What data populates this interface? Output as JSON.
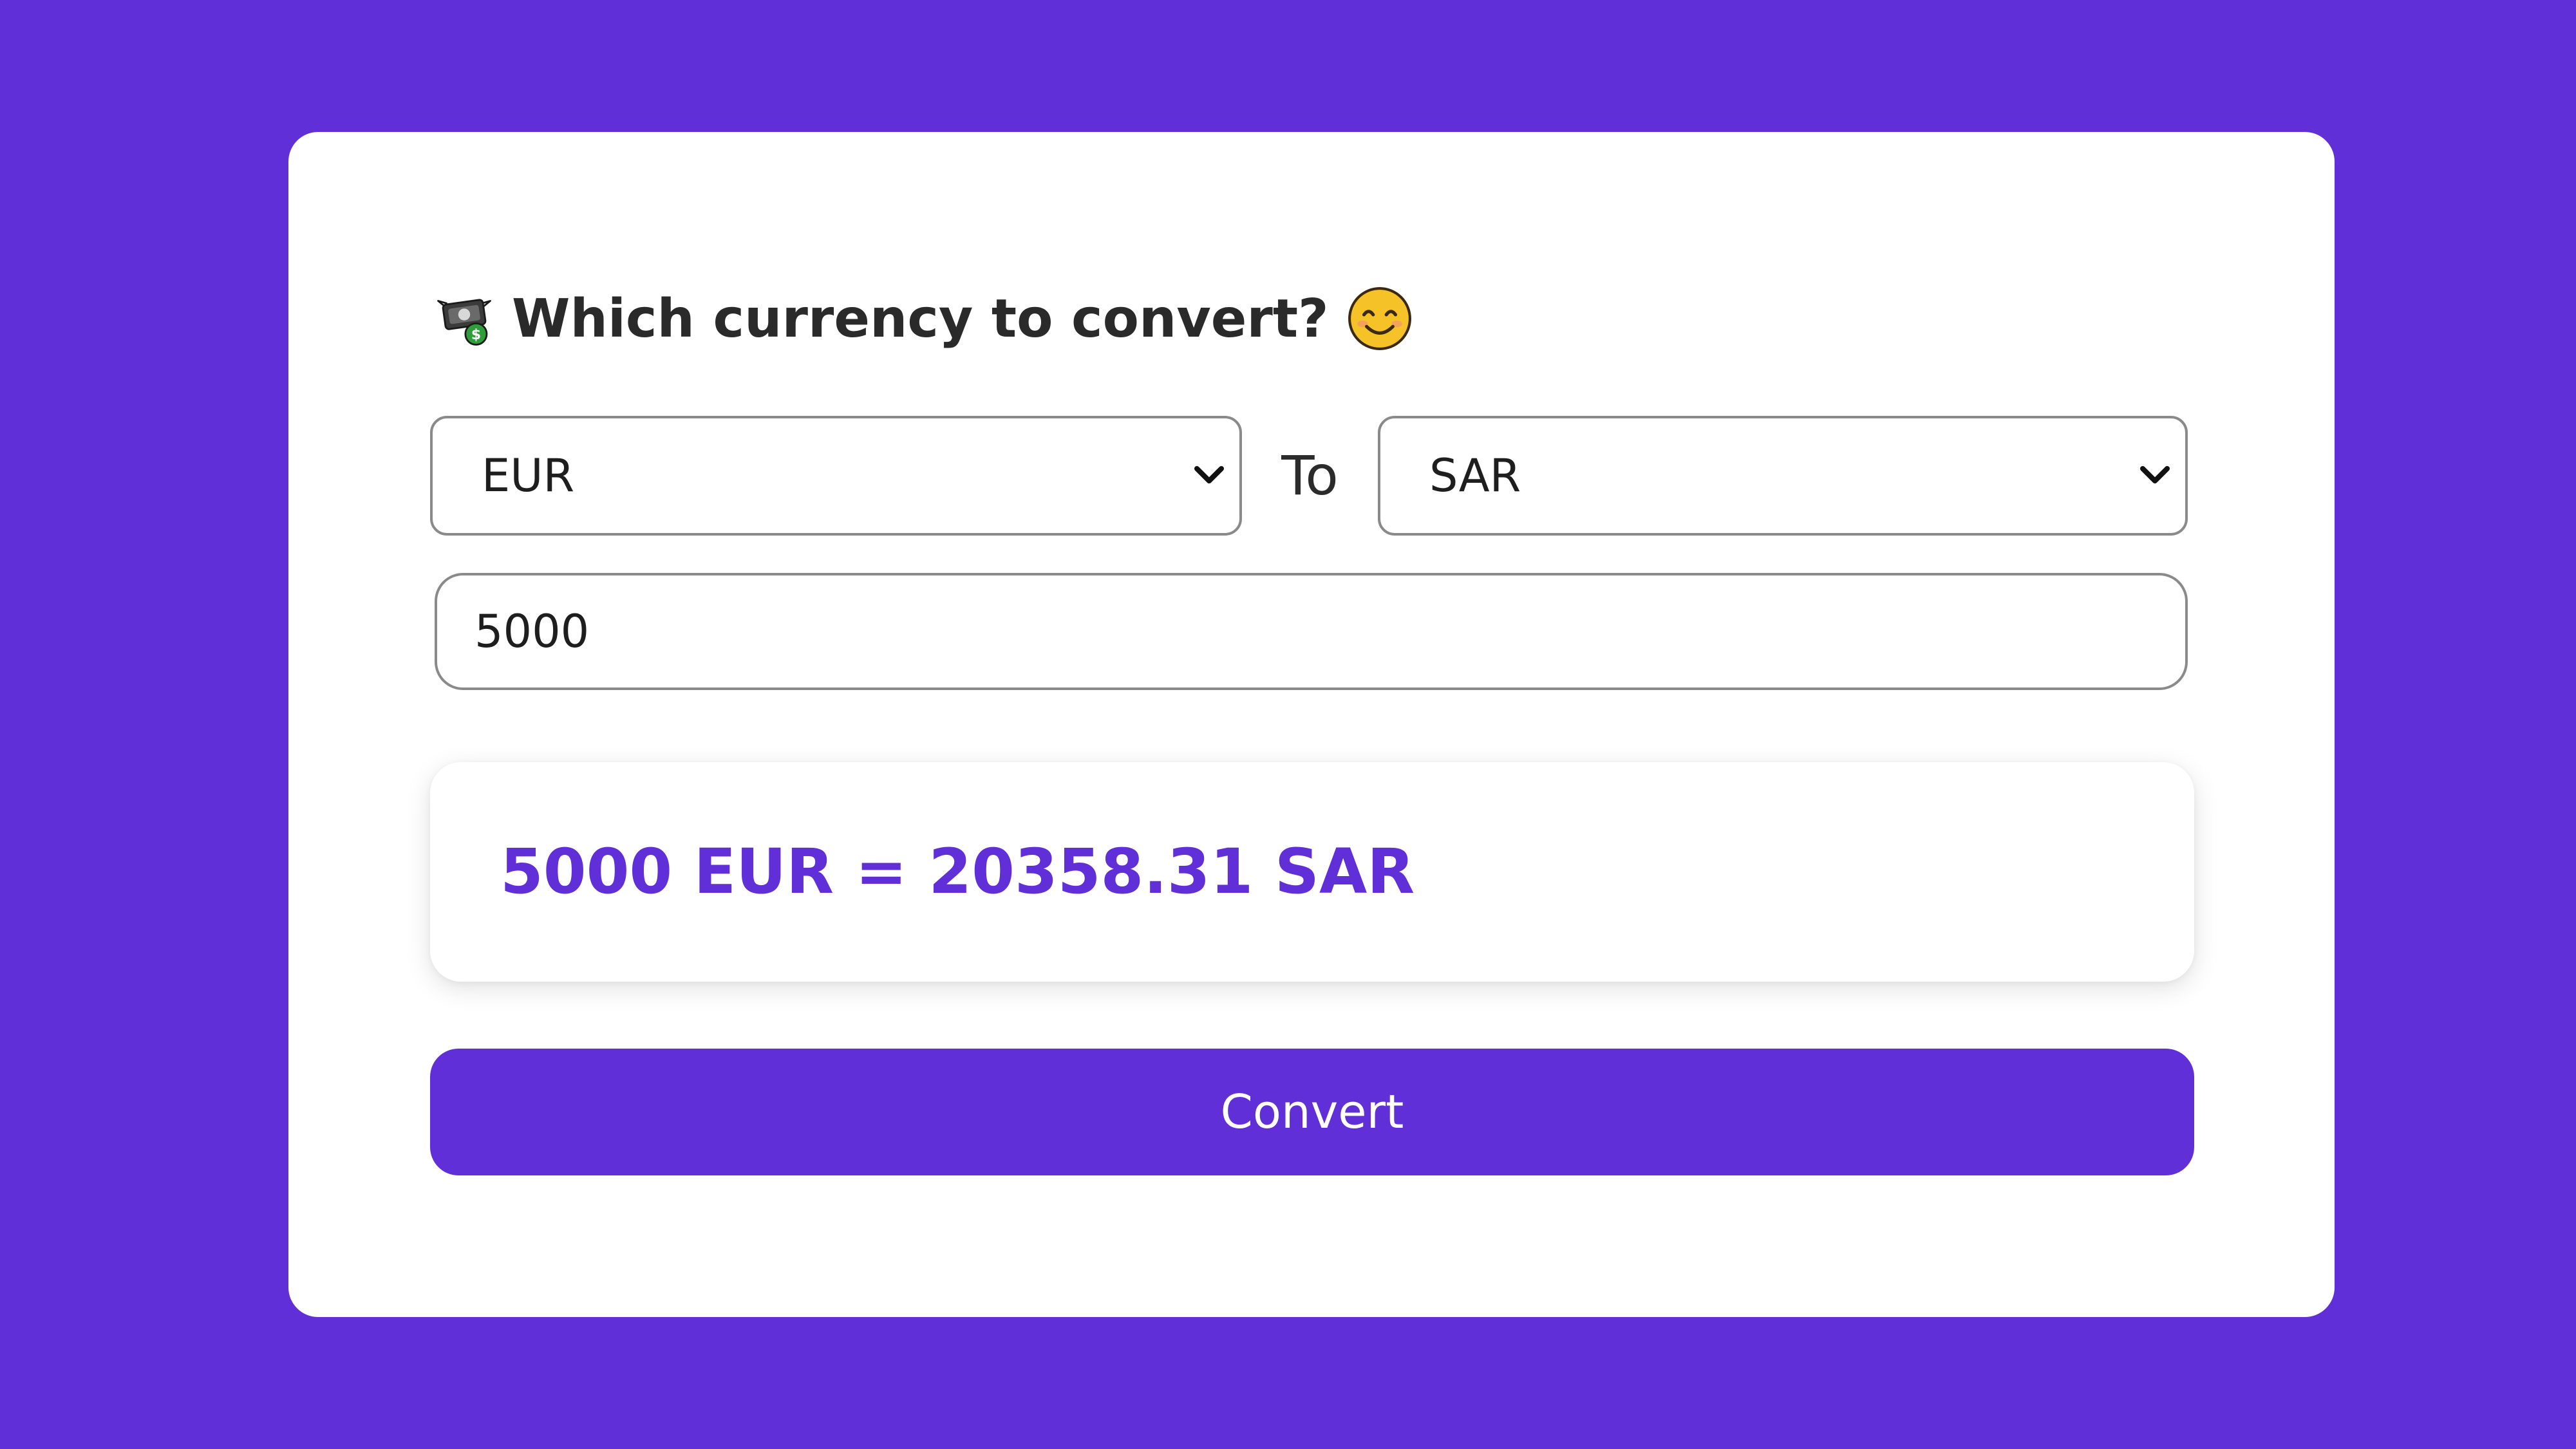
{
  "heading": {
    "text": "Which currency to convert?",
    "leading_icon": "money-with-wings-icon",
    "trailing_icon": "smiling-face-icon"
  },
  "converter": {
    "from_currency": "EUR",
    "separator": "To",
    "to_currency": "SAR",
    "amount": "5000"
  },
  "result": {
    "text": "5000 EUR = 20358.31 SAR"
  },
  "actions": {
    "convert_label": "Convert"
  },
  "colors": {
    "background": "#612fd8",
    "card": "#ffffff",
    "accent": "#612fd8",
    "heading_text": "#2a2a2a"
  }
}
